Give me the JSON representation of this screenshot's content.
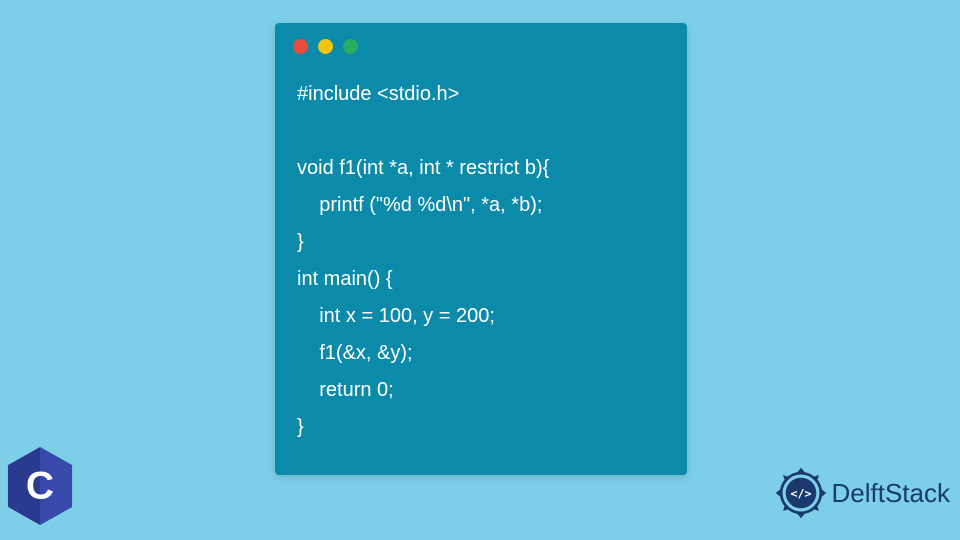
{
  "code": {
    "lines": [
      "#include <stdio.h>",
      "",
      "void f1(int *a, int * restrict b){",
      "    printf (\"%d %d\\n\", *a, *b);",
      "}",
      "int main() {",
      "    int x = 100, y = 200;",
      "    f1(&x, &y);",
      "    return 0;",
      "}"
    ]
  },
  "logos": {
    "c_letter": "C",
    "delftstack_text": "DelftStack",
    "delftstack_inner": "</>"
  },
  "colors": {
    "background": "#7dcfe8",
    "code_window": "#0b8aaa",
    "code_text": "#ffffff",
    "dot_red": "#e74c3c",
    "dot_yellow": "#f1c40f",
    "dot_green": "#27ae60",
    "c_logo": "#2a3a8f",
    "delftstack": "#1a3a6e"
  }
}
